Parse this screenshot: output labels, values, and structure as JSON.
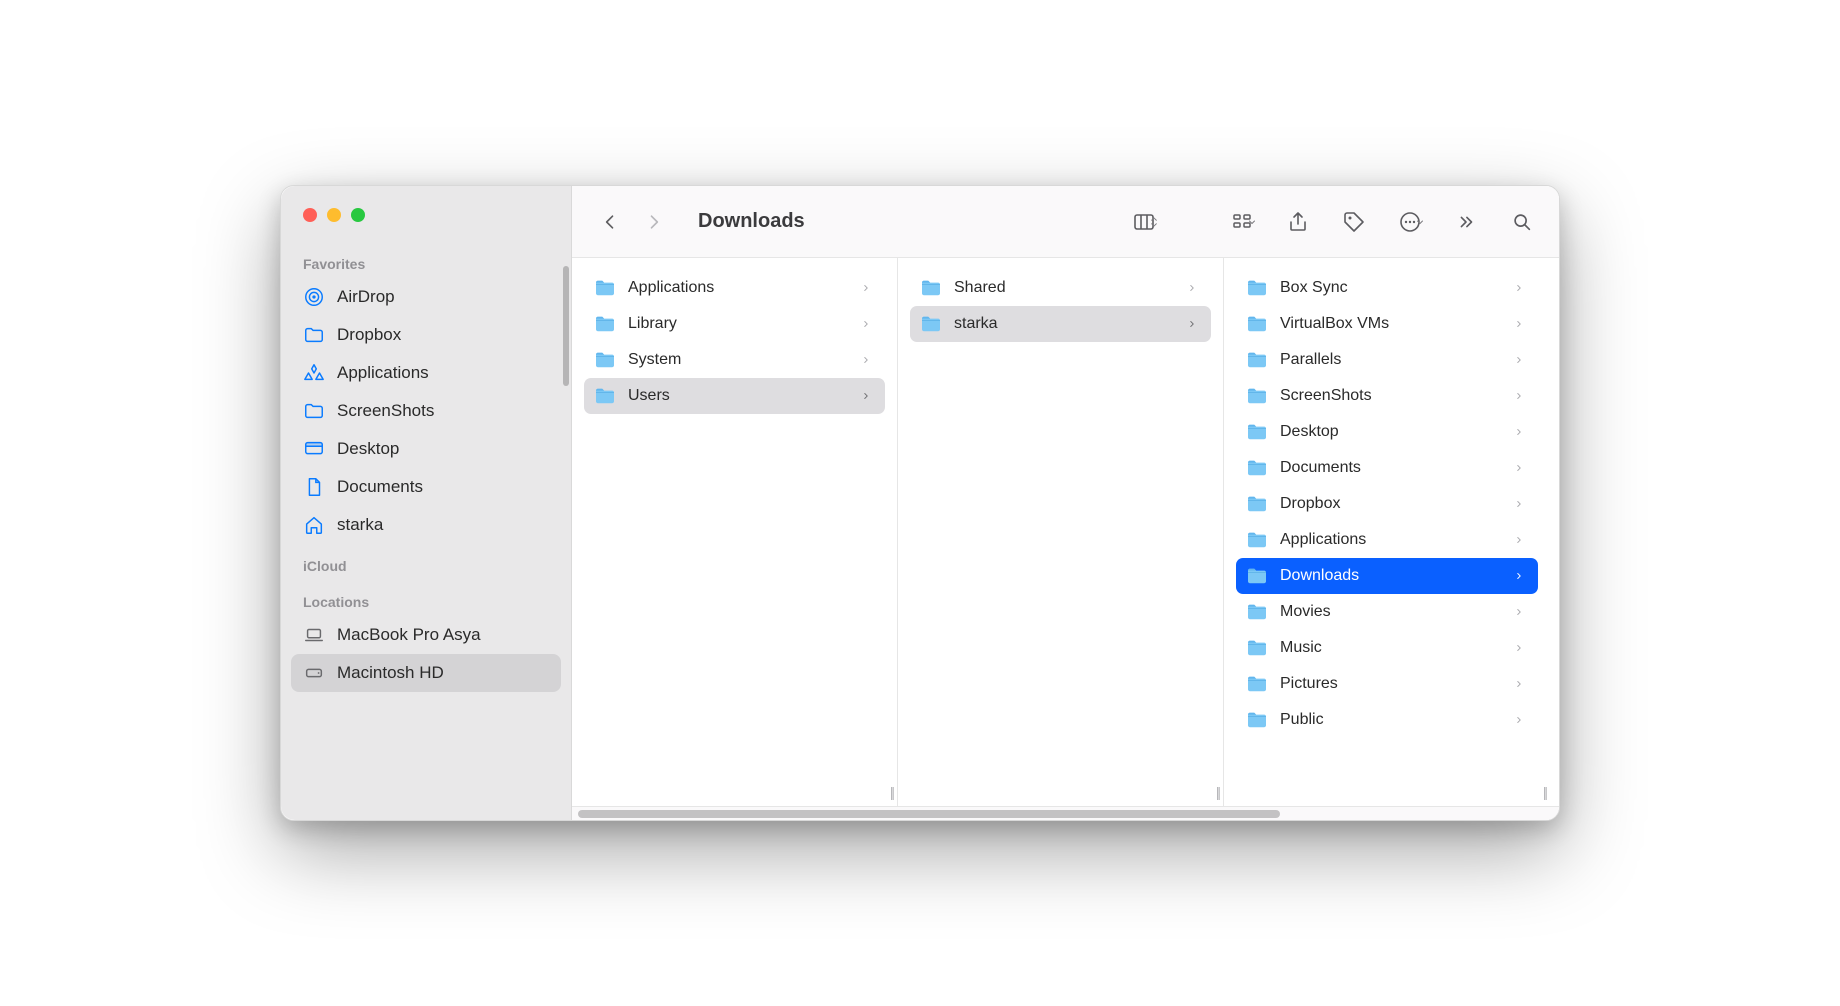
{
  "title": "Downloads",
  "sidebar": {
    "sections": [
      {
        "title": "Favorites",
        "items": [
          {
            "icon": "airdrop",
            "label": "AirDrop"
          },
          {
            "icon": "folder",
            "label": "Dropbox"
          },
          {
            "icon": "app",
            "label": "Applications"
          },
          {
            "icon": "folder",
            "label": "ScreenShots"
          },
          {
            "icon": "desktop",
            "label": "Desktop"
          },
          {
            "icon": "doc",
            "label": "Documents"
          },
          {
            "icon": "home",
            "label": "starka"
          }
        ]
      },
      {
        "title": "iCloud",
        "items": []
      },
      {
        "title": "Locations",
        "items": [
          {
            "icon": "laptop",
            "label": "MacBook Pro Asya"
          },
          {
            "icon": "disk",
            "label": "Macintosh HD",
            "selected": true
          }
        ]
      }
    ]
  },
  "columns": [
    {
      "items": [
        {
          "icon": "folder-sys",
          "label": "Applications"
        },
        {
          "icon": "folder-sys",
          "label": "Library"
        },
        {
          "icon": "folder-sys",
          "label": "System"
        },
        {
          "icon": "folder-users",
          "label": "Users",
          "selected": "grey"
        }
      ]
    },
    {
      "items": [
        {
          "icon": "folder",
          "label": "Shared"
        },
        {
          "icon": "folder-home",
          "label": "starka",
          "selected": "grey"
        }
      ]
    },
    {
      "items": [
        {
          "icon": "folder",
          "label": "Box Sync"
        },
        {
          "icon": "folder",
          "label": "VirtualBox VMs"
        },
        {
          "icon": "folder",
          "label": "Parallels"
        },
        {
          "icon": "folder",
          "label": "ScreenShots"
        },
        {
          "icon": "folder",
          "label": "Desktop"
        },
        {
          "icon": "folder",
          "label": "Documents"
        },
        {
          "icon": "folder-dropbox",
          "label": "Dropbox"
        },
        {
          "icon": "folder",
          "label": "Applications"
        },
        {
          "icon": "folder-downloads",
          "label": "Downloads",
          "selected": "blue"
        },
        {
          "icon": "folder",
          "label": "Movies"
        },
        {
          "icon": "folder-music",
          "label": "Music"
        },
        {
          "icon": "folder-pictures",
          "label": "Pictures"
        },
        {
          "icon": "folder",
          "label": "Public"
        }
      ]
    }
  ]
}
